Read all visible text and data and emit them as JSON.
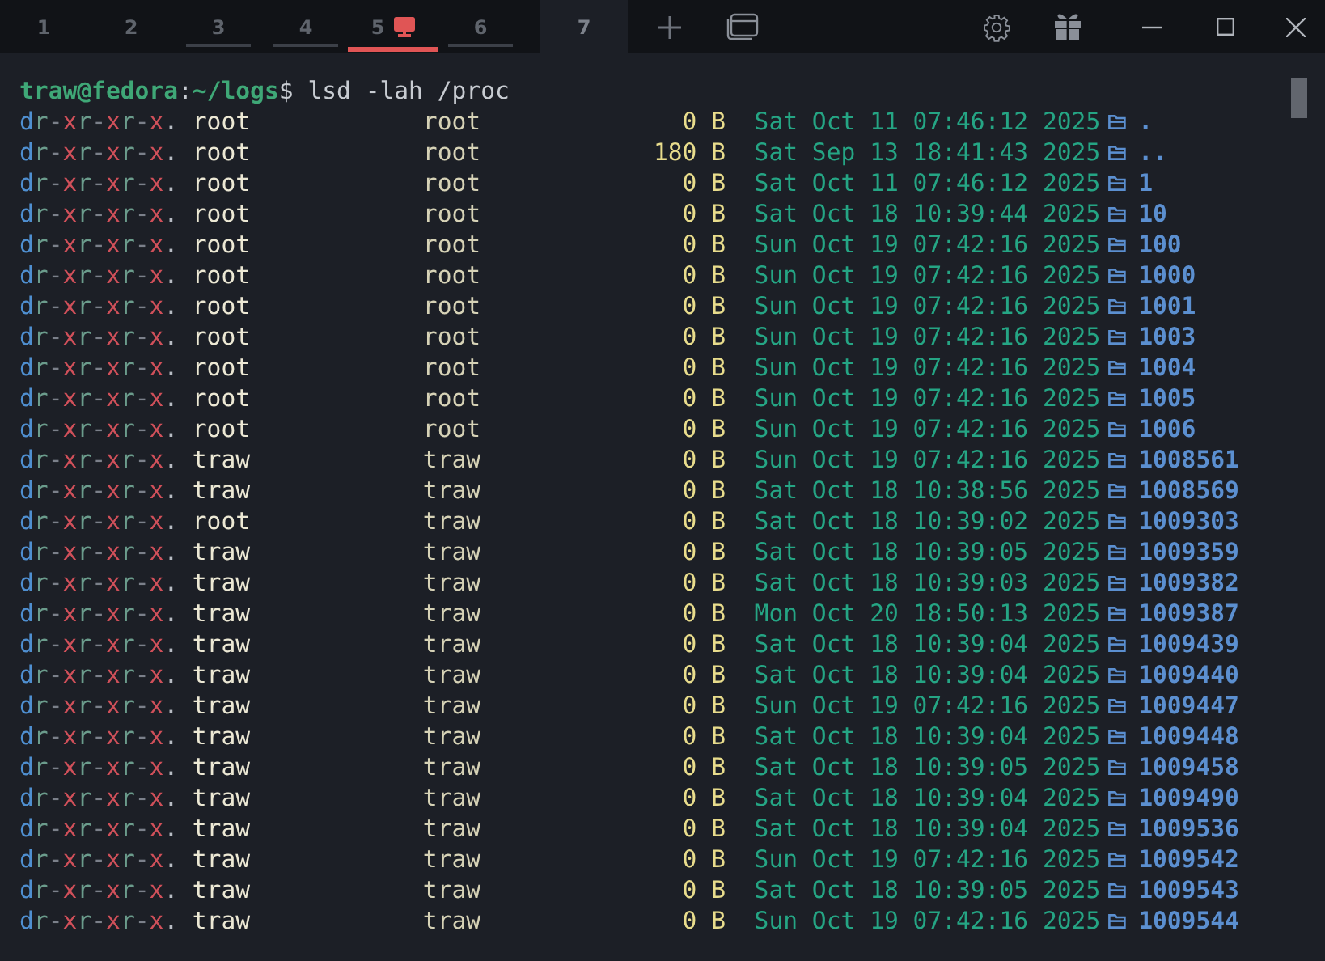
{
  "tabs": [
    {
      "label": "1",
      "selected": false,
      "underlined": false,
      "alert": false
    },
    {
      "label": "2",
      "selected": false,
      "underlined": false,
      "alert": false
    },
    {
      "label": "3",
      "selected": false,
      "underlined": true,
      "alert": false
    },
    {
      "label": "4",
      "selected": false,
      "underlined": true,
      "alert": false
    },
    {
      "label": "5",
      "selected": false,
      "underlined": true,
      "alert": true
    },
    {
      "label": "6",
      "selected": false,
      "underlined": true,
      "alert": false
    },
    {
      "label": "7",
      "selected": true,
      "underlined": false,
      "alert": false
    }
  ],
  "prompt": {
    "user_host": "traw@fedora",
    "separator": ":",
    "path": "~/logs",
    "symbol": "$",
    "command": "lsd -lah /proc"
  },
  "rows": [
    {
      "permissions": "dr-xr-xr-x.",
      "user": "root",
      "group": "root",
      "size": "0 B",
      "date": "Sat Oct 11 07:46:12 2025",
      "name": "."
    },
    {
      "permissions": "dr-xr-xr-x.",
      "user": "root",
      "group": "root",
      "size": "180 B",
      "date": "Sat Sep 13 18:41:43 2025",
      "name": ".."
    },
    {
      "permissions": "dr-xr-xr-x.",
      "user": "root",
      "group": "root",
      "size": "0 B",
      "date": "Sat Oct 11 07:46:12 2025",
      "name": "1"
    },
    {
      "permissions": "dr-xr-xr-x.",
      "user": "root",
      "group": "root",
      "size": "0 B",
      "date": "Sat Oct 18 10:39:44 2025",
      "name": "10"
    },
    {
      "permissions": "dr-xr-xr-x.",
      "user": "root",
      "group": "root",
      "size": "0 B",
      "date": "Sun Oct 19 07:42:16 2025",
      "name": "100"
    },
    {
      "permissions": "dr-xr-xr-x.",
      "user": "root",
      "group": "root",
      "size": "0 B",
      "date": "Sun Oct 19 07:42:16 2025",
      "name": "1000"
    },
    {
      "permissions": "dr-xr-xr-x.",
      "user": "root",
      "group": "root",
      "size": "0 B",
      "date": "Sun Oct 19 07:42:16 2025",
      "name": "1001"
    },
    {
      "permissions": "dr-xr-xr-x.",
      "user": "root",
      "group": "root",
      "size": "0 B",
      "date": "Sun Oct 19 07:42:16 2025",
      "name": "1003"
    },
    {
      "permissions": "dr-xr-xr-x.",
      "user": "root",
      "group": "root",
      "size": "0 B",
      "date": "Sun Oct 19 07:42:16 2025",
      "name": "1004"
    },
    {
      "permissions": "dr-xr-xr-x.",
      "user": "root",
      "group": "root",
      "size": "0 B",
      "date": "Sun Oct 19 07:42:16 2025",
      "name": "1005"
    },
    {
      "permissions": "dr-xr-xr-x.",
      "user": "root",
      "group": "root",
      "size": "0 B",
      "date": "Sun Oct 19 07:42:16 2025",
      "name": "1006"
    },
    {
      "permissions": "dr-xr-xr-x.",
      "user": "traw",
      "group": "traw",
      "size": "0 B",
      "date": "Sun Oct 19 07:42:16 2025",
      "name": "1008561"
    },
    {
      "permissions": "dr-xr-xr-x.",
      "user": "traw",
      "group": "traw",
      "size": "0 B",
      "date": "Sat Oct 18 10:38:56 2025",
      "name": "1008569"
    },
    {
      "permissions": "dr-xr-xr-x.",
      "user": "root",
      "group": "traw",
      "size": "0 B",
      "date": "Sat Oct 18 10:39:02 2025",
      "name": "1009303"
    },
    {
      "permissions": "dr-xr-xr-x.",
      "user": "traw",
      "group": "traw",
      "size": "0 B",
      "date": "Sat Oct 18 10:39:05 2025",
      "name": "1009359"
    },
    {
      "permissions": "dr-xr-xr-x.",
      "user": "traw",
      "group": "traw",
      "size": "0 B",
      "date": "Sat Oct 18 10:39:03 2025",
      "name": "1009382"
    },
    {
      "permissions": "dr-xr-xr-x.",
      "user": "traw",
      "group": "traw",
      "size": "0 B",
      "date": "Mon Oct 20 18:50:13 2025",
      "name": "1009387"
    },
    {
      "permissions": "dr-xr-xr-x.",
      "user": "traw",
      "group": "traw",
      "size": "0 B",
      "date": "Sat Oct 18 10:39:04 2025",
      "name": "1009439"
    },
    {
      "permissions": "dr-xr-xr-x.",
      "user": "traw",
      "group": "traw",
      "size": "0 B",
      "date": "Sat Oct 18 10:39:04 2025",
      "name": "1009440"
    },
    {
      "permissions": "dr-xr-xr-x.",
      "user": "traw",
      "group": "traw",
      "size": "0 B",
      "date": "Sun Oct 19 07:42:16 2025",
      "name": "1009447"
    },
    {
      "permissions": "dr-xr-xr-x.",
      "user": "traw",
      "group": "traw",
      "size": "0 B",
      "date": "Sat Oct 18 10:39:04 2025",
      "name": "1009448"
    },
    {
      "permissions": "dr-xr-xr-x.",
      "user": "traw",
      "group": "traw",
      "size": "0 B",
      "date": "Sat Oct 18 10:39:05 2025",
      "name": "1009458"
    },
    {
      "permissions": "dr-xr-xr-x.",
      "user": "traw",
      "group": "traw",
      "size": "0 B",
      "date": "Sat Oct 18 10:39:04 2025",
      "name": "1009490"
    },
    {
      "permissions": "dr-xr-xr-x.",
      "user": "traw",
      "group": "traw",
      "size": "0 B",
      "date": "Sat Oct 18 10:39:04 2025",
      "name": "1009536"
    },
    {
      "permissions": "dr-xr-xr-x.",
      "user": "traw",
      "group": "traw",
      "size": "0 B",
      "date": "Sun Oct 19 07:42:16 2025",
      "name": "1009542"
    },
    {
      "permissions": "dr-xr-xr-x.",
      "user": "traw",
      "group": "traw",
      "size": "0 B",
      "date": "Sat Oct 18 10:39:05 2025",
      "name": "1009543"
    },
    {
      "permissions": "dr-xr-xr-x.",
      "user": "traw",
      "group": "traw",
      "size": "0 B",
      "date": "Sun Oct 19 07:42:16 2025",
      "name": "1009544"
    }
  ]
}
